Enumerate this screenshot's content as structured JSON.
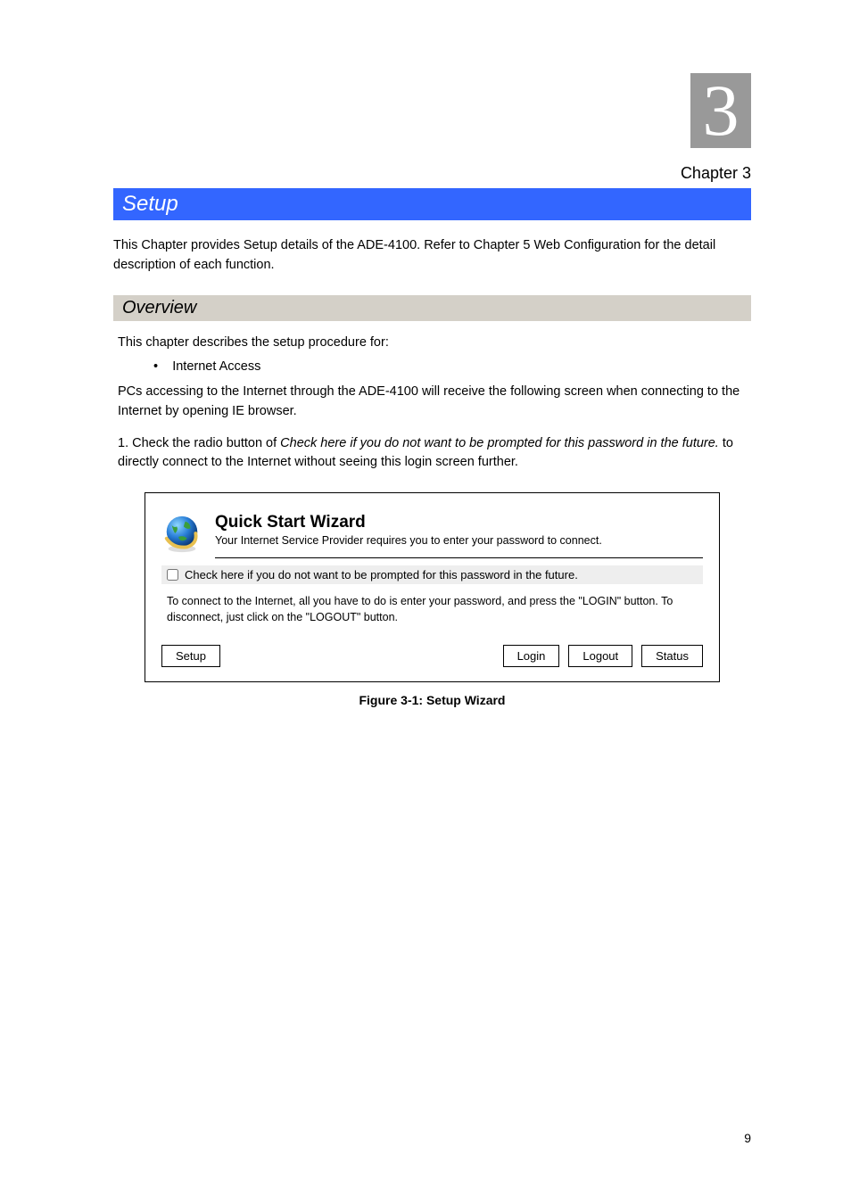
{
  "chapter": {
    "number": "3",
    "label": "Chapter 3"
  },
  "title_bar": "Setup",
  "intro": "This Chapter provides Setup details of the ADE-4100. Refer to Chapter 5 Web Configuration for the detail description of each function.",
  "section_bar": "Overview",
  "section": {
    "p1": "This chapter describes the setup procedure for:",
    "bullets": [
      "Internet Access"
    ],
    "p2": "PCs accessing to the Internet through the ADE-4100 will receive the following screen when connecting to the Internet by opening IE browser."
  },
  "steps": {
    "s1_a": "1.     Check the radio button of ",
    "s1_b": "Check here if you do not want to be prompted for this password in the future.",
    "s1_c": " to directly connect to the Internet without seeing this login screen further."
  },
  "wizard": {
    "title": "Quick Start Wizard",
    "subtitle": "Your Internet Service Provider requires you to enter your password to connect.",
    "checkbox_label": "Check here if you do not want to be prompted for this password in the future.",
    "body": "To connect to the Internet, all you have to do is enter your password, and press the \"LOGIN\" button. To disconnect, just click on the \"LOGOUT\" button.",
    "buttons": {
      "setup": "Setup",
      "login": "Login",
      "logout": "Logout",
      "status": "Status"
    }
  },
  "figure": "Figure 3-1: Setup Wizard",
  "page_number": "9"
}
